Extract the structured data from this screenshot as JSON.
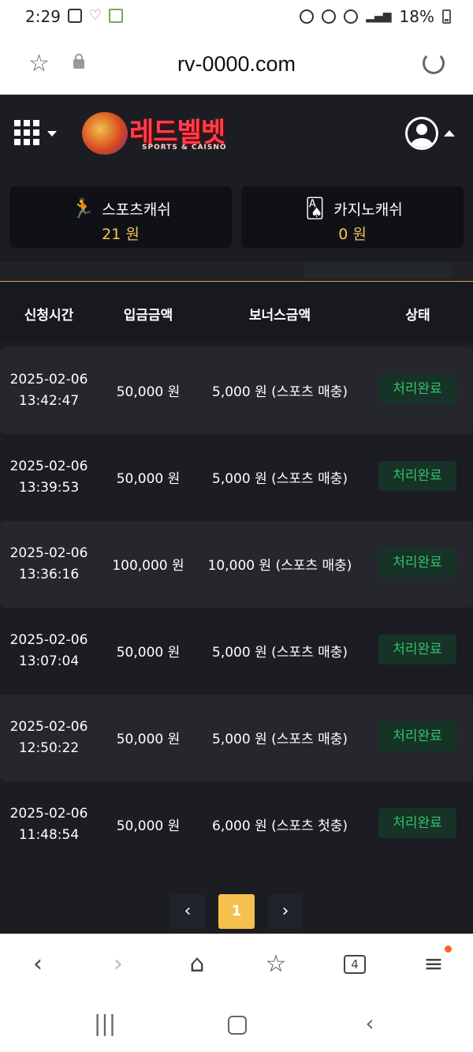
{
  "status_bar": {
    "time": "2:29",
    "battery": "18%"
  },
  "browser": {
    "url": "rv-0000.com",
    "tab_count": "4"
  },
  "header": {
    "logo_text": "레드벨벳",
    "logo_sub": "SPORTS & CAISNO"
  },
  "balances": {
    "sports": {
      "label": "스포츠캐쉬",
      "value": "21 원",
      "icon": "sports-runner-icon"
    },
    "casino": {
      "label": "카지노캐쉬",
      "value": "0 원",
      "icon": "playing-cards-icon"
    }
  },
  "table": {
    "headers": {
      "time": "신청시간",
      "amount": "입금금액",
      "bonus": "보너스금액",
      "status": "상태"
    },
    "rows": [
      {
        "date": "2025-02-06",
        "time": "13:42:47",
        "amount": "50,000 원",
        "bonus": "5,000 원 (스포츠 매충)",
        "status": "처리완료"
      },
      {
        "date": "2025-02-06",
        "time": "13:39:53",
        "amount": "50,000 원",
        "bonus": "5,000 원 (스포츠 매충)",
        "status": "처리완료"
      },
      {
        "date": "2025-02-06",
        "time": "13:36:16",
        "amount": "100,000 원",
        "bonus": "10,000 원 (스포츠 매충)",
        "status": "처리완료"
      },
      {
        "date": "2025-02-06",
        "time": "13:07:04",
        "amount": "50,000 원",
        "bonus": "5,000 원 (스포츠 매충)",
        "status": "처리완료"
      },
      {
        "date": "2025-02-06",
        "time": "12:50:22",
        "amount": "50,000 원",
        "bonus": "5,000 원 (스포츠 매충)",
        "status": "처리완료"
      },
      {
        "date": "2025-02-06",
        "time": "11:48:54",
        "amount": "50,000 원",
        "bonus": "6,000 원 (스포츠 첫충)",
        "status": "처리완료"
      }
    ]
  },
  "pagination": {
    "prev": "‹",
    "current": "1",
    "next": "›"
  },
  "colors": {
    "app_bg": "#1b1d22",
    "accent_gold": "#f5c04d",
    "status_green": "#31c36d",
    "brand_red": "#ff3e4d"
  }
}
